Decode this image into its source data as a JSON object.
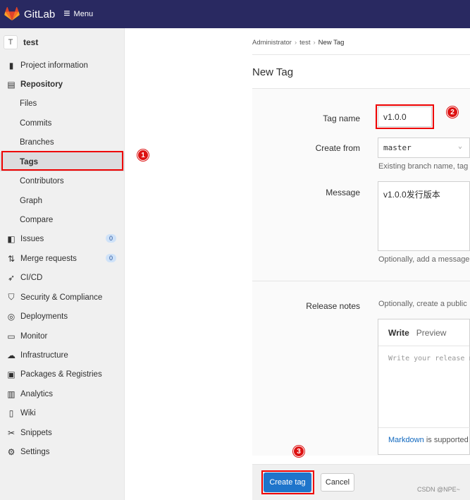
{
  "topbar": {
    "app_name": "GitLab",
    "menu_label": "Menu",
    "logo_icon": "gitlab-tanuki-logo",
    "menu_icon": "hamburger-icon",
    "bg_color": "#292961"
  },
  "sidebar": {
    "project_avatar": "T",
    "project_name": "test",
    "items": [
      {
        "label": "Project information",
        "icon": "info-icon"
      },
      {
        "label": "Repository",
        "icon": "book-icon"
      },
      {
        "label": "Files"
      },
      {
        "label": "Commits"
      },
      {
        "label": "Branches"
      },
      {
        "label": "Tags"
      },
      {
        "label": "Contributors"
      },
      {
        "label": "Graph"
      },
      {
        "label": "Compare"
      },
      {
        "label": "Issues",
        "icon": "issues-icon",
        "count": "0"
      },
      {
        "label": "Merge requests",
        "icon": "merge-request-icon",
        "count": "0"
      },
      {
        "label": "CI/CD",
        "icon": "rocket-icon"
      },
      {
        "label": "Security & Compliance",
        "icon": "shield-icon"
      },
      {
        "label": "Deployments",
        "icon": "deployments-icon"
      },
      {
        "label": "Monitor",
        "icon": "monitor-icon"
      },
      {
        "label": "Infrastructure",
        "icon": "cloud-icon"
      },
      {
        "label": "Packages & Registries",
        "icon": "package-icon"
      },
      {
        "label": "Analytics",
        "icon": "chart-icon"
      },
      {
        "label": "Wiki",
        "icon": "book-icon"
      },
      {
        "label": "Snippets",
        "icon": "scissors-icon"
      },
      {
        "label": "Settings",
        "icon": "gear-icon"
      }
    ]
  },
  "breadcrumb": {
    "items": [
      "Administrator",
      "test",
      "New Tag"
    ]
  },
  "page_title": "New Tag",
  "form": {
    "tag_name_label": "Tag name",
    "tag_name_value": "v1.0.0",
    "create_from_label": "Create from",
    "create_from_value": "master",
    "create_from_help": "Existing branch name, tag",
    "message_label": "Message",
    "message_value": "v1.0.0发行版本",
    "message_help": "Optionally, add a message",
    "release_notes_label": "Release notes",
    "release_notes_help": "Optionally, create a public",
    "editor": {
      "tab_write": "Write",
      "tab_preview": "Preview",
      "placeholder": "Write your release n",
      "footer_link": "Markdown",
      "footer_text": "is supported"
    }
  },
  "footer": {
    "create_label": "Create tag",
    "cancel_label": "Cancel"
  },
  "annotations": {
    "m1": "1",
    "m2": "2",
    "m3": "3",
    "highlight_color": "#ee0000"
  },
  "watermark": "CSDN @NPE~"
}
